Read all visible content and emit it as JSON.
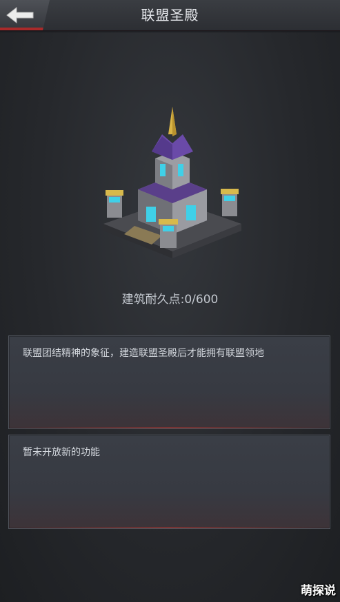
{
  "header": {
    "title": "联盟圣殿",
    "back_icon": "back-arrow-icon"
  },
  "building": {
    "name_icon": "alliance-temple-icon"
  },
  "durability": {
    "text": "建筑耐久点:0/600"
  },
  "panels": [
    {
      "text": "联盟团结精神的象征，建造联盟圣殿后才能拥有联盟领地"
    },
    {
      "text": "暂未开放新的功能"
    }
  ],
  "watermark": {
    "text": "萌探说"
  },
  "colors": {
    "accent": "#a92a2a",
    "background": "#26282c",
    "panel": "#373a42"
  }
}
